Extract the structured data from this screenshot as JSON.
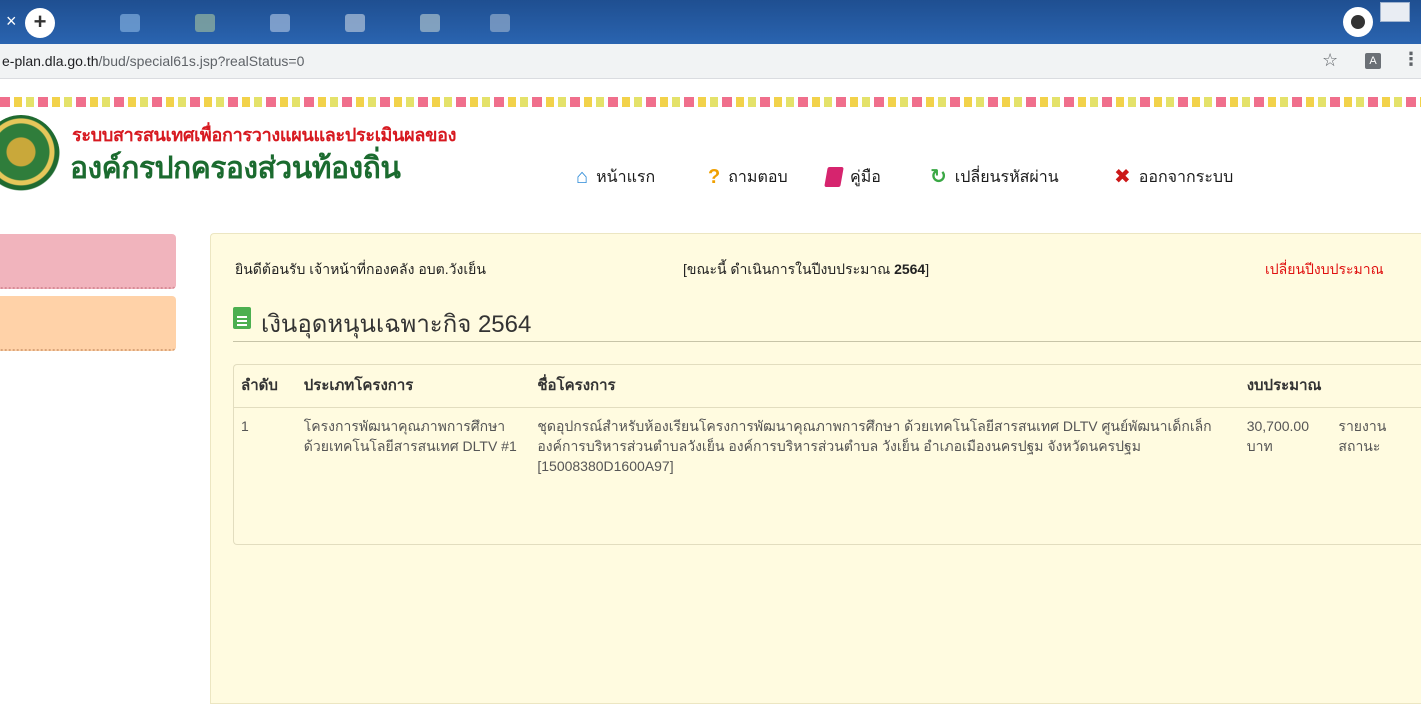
{
  "browser": {
    "close_glyph": "×",
    "newtab_glyph": "+",
    "url_host": "e-plan.dla.go.th",
    "url_path": "/bud/special61s.jsp?realStatus=0",
    "star_glyph": "☆",
    "more_glyph": "⋮"
  },
  "site": {
    "title_line1": "ระบบสารสนเทศเพื่อการวางแผนและประเมินผลของ",
    "title_line2": "องค์กรปกครองส่วนท้องถิ่น"
  },
  "nav": [
    {
      "label": "หน้าแรก",
      "icon": "home-icon",
      "glyph": "⌂"
    },
    {
      "label": "ถามตอบ",
      "icon": "question-icon",
      "glyph": "?"
    },
    {
      "label": "คู่มือ",
      "icon": "book-icon",
      "glyph": ""
    },
    {
      "label": "เปลี่ยนรหัสผ่าน",
      "icon": "refresh-icon",
      "glyph": "↻"
    },
    {
      "label": "ออกจากระบบ",
      "icon": "close-icon",
      "glyph": "✖"
    }
  ],
  "main": {
    "welcome": "ยินดีต้อนรับ เจ้าหน้าที่กองคลัง อบต.วังเย็น",
    "fiscal_prefix": "[ขณะนี้ ดำเนินการในปีงบประมาณ ",
    "fiscal_year": "2564",
    "fiscal_suffix": "]",
    "change_year": "เปลี่ยนปีงบประมาณ",
    "heading": "เงินอุดหนุนเฉพาะกิจ 2564"
  },
  "table": {
    "headers": [
      "ลำดับ",
      "ประเภทโครงการ",
      "ชื่อโครงการ",
      "งบประมาณ",
      ""
    ],
    "rows": [
      {
        "no": "1",
        "type": "โครงการพัฒนาคุณภาพการศึกษาด้วยเทคโนโลยีสารสนเทศ DLTV #1",
        "name": "ชุดอุปกรณ์สำหรับห้องเรียนโครงการพัฒนาคุณภาพการศึกษา ด้วยเทคโนโลยีสารสนเทศ DLTV ศูนย์พัฒนาเด็กเล็ก องค์การบริหารส่วนตำบลวังเย็น องค์การบริหารส่วนตำบล วังเย็น อำเภอเมืองนครปฐม จังหวัดนครปฐม",
        "code": "[15008380D1600A97]",
        "budget": "30,700.00",
        "budget_unit": "บาท",
        "report": "รายงานสถานะ"
      }
    ]
  }
}
